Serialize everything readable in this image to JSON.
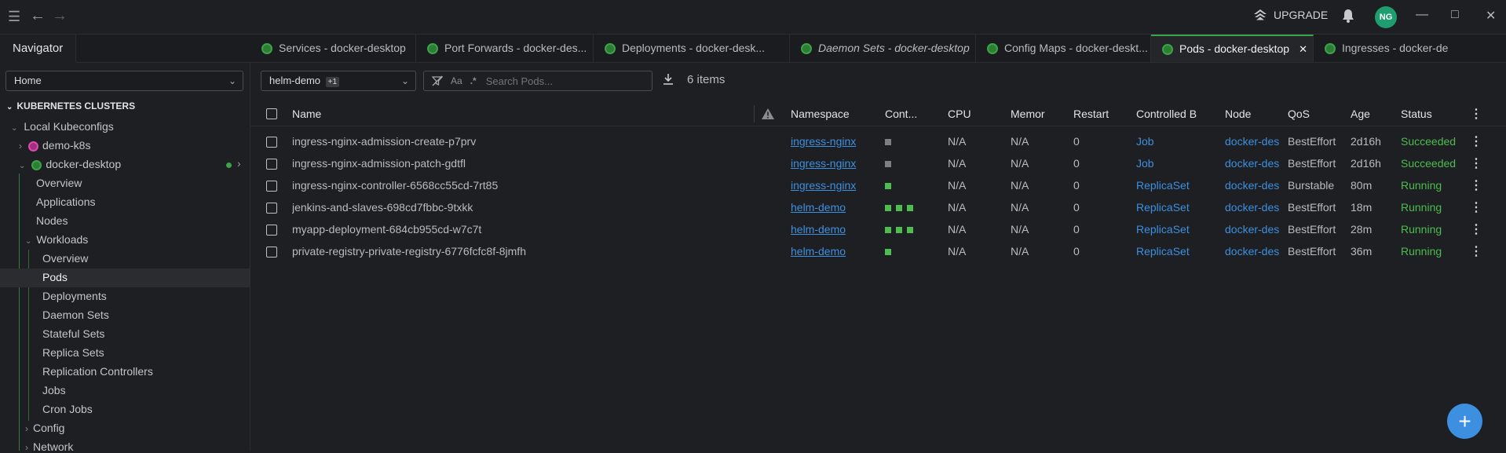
{
  "topbar": {
    "upgrade_label": "UPGRADE",
    "avatar_initials": "NG"
  },
  "navigator": {
    "title": "Navigator",
    "location_select": "Home",
    "section_title": "KUBERNETES CLUSTERS",
    "tree": {
      "local_kubeconfigs": "Local Kubeconfigs",
      "demo_k8s": "demo-k8s",
      "docker_desktop": "docker-desktop",
      "overview": "Overview",
      "applications": "Applications",
      "nodes": "Nodes",
      "workloads": "Workloads",
      "wl_overview": "Overview",
      "pods": "Pods",
      "deployments": "Deployments",
      "daemon_sets": "Daemon Sets",
      "stateful_sets": "Stateful Sets",
      "replica_sets": "Replica Sets",
      "replication_controllers": "Replication Controllers",
      "jobs": "Jobs",
      "cron_jobs": "Cron Jobs",
      "config": "Config",
      "network": "Network"
    }
  },
  "tabs": [
    {
      "label": "Services - docker-desktop"
    },
    {
      "label": "Port Forwards - docker-des..."
    },
    {
      "label": "Deployments - docker-desk..."
    },
    {
      "label": "Daemon Sets - docker-desktop"
    },
    {
      "label": "Config Maps - docker-deskt..."
    },
    {
      "label": "Pods - docker-desktop"
    },
    {
      "label": "Ingresses - docker-de"
    }
  ],
  "toolbar": {
    "namespace_select": "helm-demo",
    "namespace_extra": "+1",
    "search_placeholder": "Search Pods...",
    "case_label": "Aa",
    "regex_label": ".*",
    "items_count": "6 items"
  },
  "table": {
    "headers": [
      "Name",
      "Namespace",
      "Cont...",
      "CPU",
      "Memor",
      "Restart",
      "Controlled B",
      "Node",
      "QoS",
      "Age",
      "Status"
    ],
    "rows": [
      {
        "name": "ingress-nginx-admission-create-p7prv",
        "namespace": "ingress-nginx",
        "containers": [
          "x"
        ],
        "cpu": "N/A",
        "memory": "N/A",
        "restarts": "0",
        "controlled_by": "Job",
        "node": "docker-des",
        "qos": "BestEffort",
        "age": "2d16h",
        "status": "Succeeded"
      },
      {
        "name": "ingress-nginx-admission-patch-gdtfl",
        "namespace": "ingress-nginx",
        "containers": [
          "x"
        ],
        "cpu": "N/A",
        "memory": "N/A",
        "restarts": "0",
        "controlled_by": "Job",
        "node": "docker-des",
        "qos": "BestEffort",
        "age": "2d16h",
        "status": "Succeeded"
      },
      {
        "name": "ingress-nginx-controller-6568cc55cd-7rt85",
        "namespace": "ingress-nginx",
        "containers": [
          "g"
        ],
        "cpu": "N/A",
        "memory": "N/A",
        "restarts": "0",
        "controlled_by": "ReplicaSet",
        "node": "docker-des",
        "qos": "Burstable",
        "age": "80m",
        "status": "Running"
      },
      {
        "name": "jenkins-and-slaves-698cd7fbbc-9txkk",
        "namespace": "helm-demo",
        "containers": [
          "g",
          "g",
          "g"
        ],
        "cpu": "N/A",
        "memory": "N/A",
        "restarts": "0",
        "controlled_by": "ReplicaSet",
        "node": "docker-des",
        "qos": "BestEffort",
        "age": "18m",
        "status": "Running"
      },
      {
        "name": "myapp-deployment-684cb955cd-w7c7t",
        "namespace": "helm-demo",
        "containers": [
          "g",
          "g",
          "g"
        ],
        "cpu": "N/A",
        "memory": "N/A",
        "restarts": "0",
        "controlled_by": "ReplicaSet",
        "node": "docker-des",
        "qos": "BestEffort",
        "age": "28m",
        "status": "Running"
      },
      {
        "name": "private-registry-private-registry-6776fcfc8f-8jmfh",
        "namespace": "helm-demo",
        "containers": [
          "g"
        ],
        "cpu": "N/A",
        "memory": "N/A",
        "restarts": "0",
        "controlled_by": "ReplicaSet",
        "node": "docker-des",
        "qos": "BestEffort",
        "age": "36m",
        "status": "Running"
      }
    ]
  },
  "colors": {
    "accent": "#3ba44a",
    "link": "#3d8fe0",
    "status_green": "#4cbd4f",
    "background": "#1e1f22"
  },
  "icons": [
    "menu-icon",
    "back-arrow-icon",
    "forward-arrow-icon",
    "upgrade-icon",
    "bell-icon",
    "minimize-icon",
    "maximize-icon",
    "close-icon",
    "kubernetes-icon",
    "filter-icon",
    "download-icon",
    "warning-icon",
    "kebab-icon",
    "plus-icon"
  ]
}
